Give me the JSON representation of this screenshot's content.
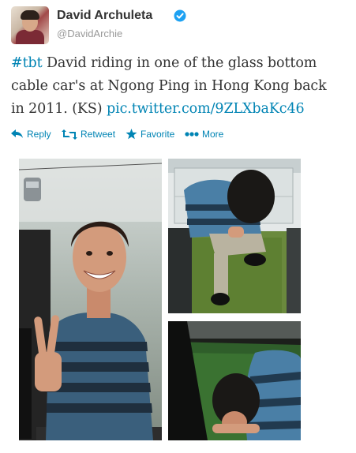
{
  "user": {
    "display_name": "David Archuleta",
    "handle": "@DavidArchie",
    "verified": true,
    "avatar_icon": "profile-photo"
  },
  "tweet": {
    "hashtag": "#tbt",
    "text_line1": " David riding in one of the glass bottom",
    "text_line2": "cable car's at Ngong Ping in Hong Kong back",
    "text_line3": "in 2011. (KS) ",
    "link": "pic.twitter.com/9ZLXbaKc46"
  },
  "actions": {
    "reply": "Reply",
    "retweet": "Retweet",
    "favorite": "Favorite",
    "more": "More"
  },
  "colors": {
    "link": "#0084b4",
    "text": "#333333",
    "muted": "#999999",
    "verified": "#1da1f2"
  },
  "photos": [
    {
      "name": "cable-car-smiling-peace-sign-photo"
    },
    {
      "name": "cable-car-looking-down-glass-floor-photo"
    },
    {
      "name": "cable-car-glass-floor-close-up-photo"
    }
  ]
}
